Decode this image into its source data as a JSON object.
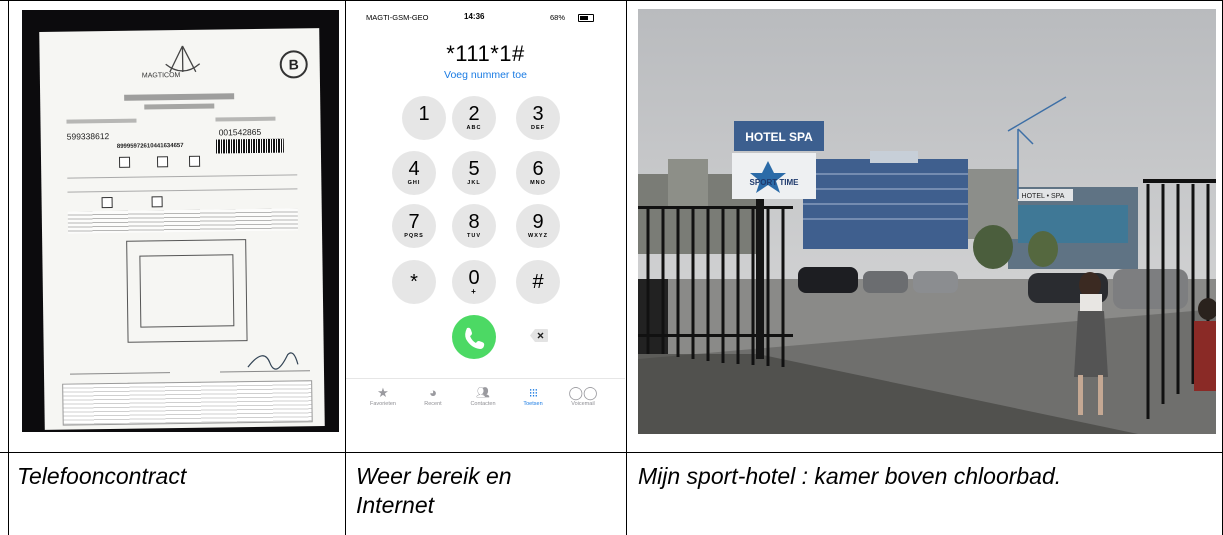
{
  "captions": {
    "col1": "Telefooncontract",
    "col2": "Weer bereik en Internet",
    "col3": "Mijn sport-hotel : kamer boven chloorbad."
  },
  "contract_photo": {
    "letter": "B",
    "logo_text": "MAGTICOM",
    "phone_number": "599338612",
    "account_number": "001542865",
    "serial": "89995972610441634657"
  },
  "phone": {
    "status": {
      "carrier": "MAGTI-GSM-GEO",
      "time": "14:36",
      "battery": "68%"
    },
    "dialed": "*111*1#",
    "add_number": "Voeg nummer toe",
    "keys": [
      {
        "d": "1",
        "l": ""
      },
      {
        "d": "2",
        "l": "ABC"
      },
      {
        "d": "3",
        "l": "DEF"
      },
      {
        "d": "4",
        "l": "GHI"
      },
      {
        "d": "5",
        "l": "JKL"
      },
      {
        "d": "6",
        "l": "MNO"
      },
      {
        "d": "7",
        "l": "PQRS"
      },
      {
        "d": "8",
        "l": "TUV"
      },
      {
        "d": "9",
        "l": "WXYZ"
      },
      {
        "d": "*",
        "l": ""
      },
      {
        "d": "0",
        "l": "+"
      },
      {
        "d": "#",
        "l": ""
      }
    ],
    "tabs": [
      "Favorieten",
      "Recent",
      "Contacten",
      "Toetsen",
      "Voicemail"
    ],
    "active_tab": "Toetsen",
    "colors": {
      "call": "#4cd964",
      "accent": "#1a7be3"
    }
  },
  "hotel_photo": {
    "sign_text_1": "HOTEL SPA",
    "sign_text_2": "SPORT TIME",
    "building_sign": "HOTEL • SPA"
  }
}
